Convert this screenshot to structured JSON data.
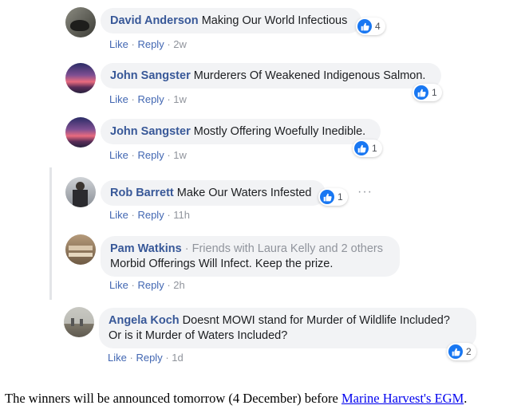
{
  "comments": [
    {
      "author": "David Anderson",
      "text": "Making Our World Infectious",
      "likes": "4",
      "like_label": "Like",
      "reply_label": "Reply",
      "sep": "·",
      "time": "2w"
    },
    {
      "author": "John Sangster",
      "text": "Murderers Of Weakened Indigenous Salmon.",
      "likes": "1",
      "like_label": "Like",
      "reply_label": "Reply",
      "sep": "·",
      "time": "1w"
    },
    {
      "author": "John Sangster",
      "text": "Mostly Offering Woefully Inedible.",
      "likes": "1",
      "like_label": "Like",
      "reply_label": "Reply",
      "sep": "·",
      "time": "1w"
    },
    {
      "author": "Rob Barrett",
      "text": "Make Our Waters Infested",
      "likes": "1",
      "like_label": "Like",
      "reply_label": "Reply",
      "sep": "·",
      "time": "11h",
      "more": "···"
    },
    {
      "author": "Pam Watkins",
      "social": "· Friends with Laura Kelly and 2 others",
      "text": "Morbid Offerings Will Infect. Keep the prize.",
      "like_label": "Like",
      "reply_label": "Reply",
      "sep": "·",
      "time": "2h"
    },
    {
      "author": "Angela Koch",
      "text_line1": "Doesnt MOWI stand for Murder of Wildlife Included?",
      "text_line2": "Or is it Murder of Waters Included?",
      "likes": "2",
      "like_label": "Like",
      "reply_label": "Reply",
      "sep": "·",
      "time": "1d"
    }
  ],
  "footer": {
    "text": "The winners will be announced tomorrow (4 December) before ",
    "link": "Marine Harvest's EGM",
    "end": "."
  },
  "colors": {
    "author": "#385898",
    "bubble": "#f2f3f5",
    "link": "#4267b2",
    "like_blue": "#1877f2"
  }
}
